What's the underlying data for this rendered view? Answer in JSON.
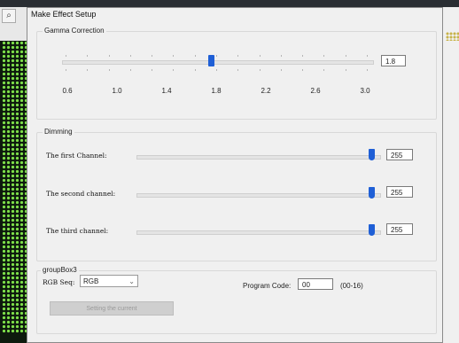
{
  "window": {
    "title": "Make Effect Setup"
  },
  "search_icon": "search-icon",
  "gamma": {
    "group_label": "Gamma Correction",
    "value": "1.8",
    "ticks": [
      "0.6",
      "1.0",
      "1.4",
      "1.8",
      "2.2",
      "2.6",
      "3.0"
    ]
  },
  "dimming": {
    "group_label": "Dimming",
    "channels": [
      {
        "label": "The first Channel:",
        "value": "255"
      },
      {
        "label": "The second channel:",
        "value": "255"
      },
      {
        "label": "The third channel:",
        "value": "255"
      }
    ]
  },
  "groupbox3": {
    "group_label": "groupBox3",
    "rgb_label": "RGB Seq:",
    "rgb_value": "RGB",
    "program_code_label": "Program Code:",
    "program_code_value": "00",
    "program_code_range": "(00-16)",
    "set_button_label": "Setting the current"
  },
  "colors": {
    "slider_thumb": "#1f5fd6",
    "led_green": "#7ee04a"
  }
}
